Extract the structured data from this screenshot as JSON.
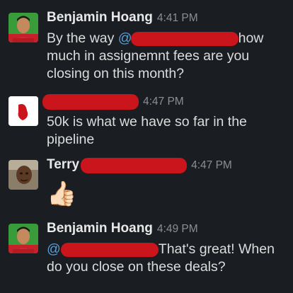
{
  "messages": [
    {
      "sender": "Benjamin Hoang",
      "time": "4:41 PM",
      "text_before": "By the way ",
      "mention": "@",
      "text_after": "how much in assignemnt fees are you closing on this month?"
    },
    {
      "sender": "",
      "time": "4:47 PM",
      "text": "50k is what we have so far in the pipeline"
    },
    {
      "sender": "Terry",
      "time": "4:47 PM",
      "emoji": "👍🏻"
    },
    {
      "sender": "Benjamin Hoang",
      "time": "4:49 PM",
      "mention": "@",
      "text_after": "That's great! When do you close on these deals?"
    }
  ]
}
